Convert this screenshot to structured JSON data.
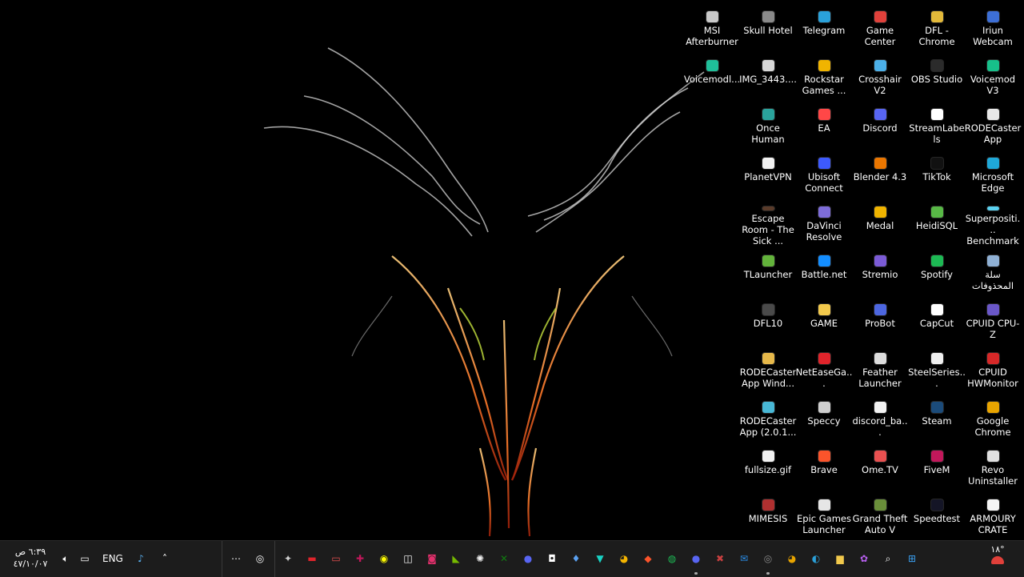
{
  "desktop": {
    "icons": [
      {
        "label": "MSI Afterburner",
        "color": "#c9c9c9"
      },
      {
        "label": "Skull Hotel",
        "color": "#8a8a8a"
      },
      {
        "label": "Telegram",
        "color": "#2aa1da"
      },
      {
        "label": "Game Center",
        "color": "#e0413b"
      },
      {
        "label": "DFL - Chrome",
        "color": "#e3b93a"
      },
      {
        "label": "Iriun Webcam",
        "color": "#3d6fd6"
      },
      {
        "label": "Voicemodl...",
        "color": "#1fbf9a"
      },
      {
        "label": "IMG_3443....",
        "color": "#d7d7d7"
      },
      {
        "label": "Rockstar Games ...",
        "color": "#f0b400"
      },
      {
        "label": "Crosshair V2",
        "color": "#4cb0e8"
      },
      {
        "label": "OBS Studio",
        "color": "#2b2b2b"
      },
      {
        "label": "Voicemod V3",
        "color": "#17c08a"
      },
      {
        "label": "Once Human",
        "color": "#2aa39c"
      },
      {
        "label": "EA",
        "color": "#ff4747"
      },
      {
        "label": "Discord",
        "color": "#5865f2"
      },
      {
        "label": "StreamLabels",
        "color": "#ffffff"
      },
      {
        "label": "RODECaster App",
        "color": "#e8e8e8"
      },
      {
        "label": "PlanetVPN",
        "color": "#f2f2f2"
      },
      {
        "label": "Ubisoft Connect",
        "color": "#3d5afe"
      },
      {
        "label": "Blender 4.3",
        "color": "#ea7600"
      },
      {
        "label": "TikTok",
        "color": "#111111"
      },
      {
        "label": "Microsoft Edge",
        "color": "#1fa8d8"
      },
      {
        "label": "Escape Room - The Sick ...",
        "color": "#5a3b2a"
      },
      {
        "label": "DaVinci Resolve",
        "color": "#7d6cd9"
      },
      {
        "label": "Medal",
        "color": "#f0b400"
      },
      {
        "label": "HeidiSQL",
        "color": "#58b846"
      },
      {
        "label": "Superpositi... Benchmark",
        "color": "#5ad1f0"
      },
      {
        "label": "TLauncher",
        "color": "#63b33b"
      },
      {
        "label": "Battle.net",
        "color": "#148eff"
      },
      {
        "label": "Stremio",
        "color": "#7b5bd6"
      },
      {
        "label": "Spotify",
        "color": "#1db954"
      },
      {
        "label": "سلة المحذوفات",
        "color": "#8fb0d4"
      },
      {
        "label": "DFL10",
        "color": "#4a4a4a"
      },
      {
        "label": "GAME",
        "color": "#f2c94c"
      },
      {
        "label": "ProBot",
        "color": "#4c66e0"
      },
      {
        "label": "CapCut",
        "color": "#ffffff"
      },
      {
        "label": "CPUID CPU-Z",
        "color": "#6a57c8"
      },
      {
        "label": "RODECaster App Wind...",
        "color": "#e6b84a"
      },
      {
        "label": "NetEaseGa...",
        "color": "#e0242b"
      },
      {
        "label": "Feather Launcher",
        "color": "#dcdcdc"
      },
      {
        "label": "SteelSeries...",
        "color": "#f0f0f0"
      },
      {
        "label": "CPUID HWMonitor",
        "color": "#d62828"
      },
      {
        "label": "RODECaster App (2.0.1...",
        "color": "#48b8d6"
      },
      {
        "label": "Speccy",
        "color": "#cfcfcf"
      },
      {
        "label": "discord_ba...",
        "color": "#f2f2f2"
      },
      {
        "label": "Steam",
        "color": "#1b4b7a"
      },
      {
        "label": "Google Chrome",
        "color": "#e8a400"
      },
      {
        "label": "fullsize.gif",
        "color": "#f2f2f2"
      },
      {
        "label": "Brave",
        "color": "#fb542b"
      },
      {
        "label": "Ome.TV",
        "color": "#e85050"
      },
      {
        "label": "FiveM",
        "color": "#c2185b"
      },
      {
        "label": "Revo Uninstaller",
        "color": "#e0e0e0"
      },
      {
        "label": "MIMESIS",
        "color": "#b03030"
      },
      {
        "label": "Epic Games Launcher",
        "color": "#e6e6e6"
      },
      {
        "label": "Grand Theft Auto V",
        "color": "#6a8f3a"
      },
      {
        "label": "Speedtest",
        "color": "#141526"
      },
      {
        "label": "ARMOURY CRATE",
        "color": "#f5f5f5"
      }
    ]
  },
  "taskbar": {
    "clock_time": "٦:٣٩ ص",
    "clock_date": "٤٧/١٠/٠٧",
    "language": "ENG",
    "weather_temp": "١٨°",
    "apps": [
      {
        "name": "search-app-icon",
        "color": "#ffffff",
        "glyph": "◎"
      },
      {
        "name": "msi-afterburner-icon",
        "color": "#d0d0d0",
        "glyph": "✦"
      },
      {
        "name": "netease-icon",
        "color": "#e0242b",
        "glyph": "▬"
      },
      {
        "name": "ome-tv-icon",
        "color": "#e85050",
        "glyph": "▭"
      },
      {
        "name": "fivem-icon",
        "color": "#c2185b",
        "glyph": "✚"
      },
      {
        "name": "snapchat-icon",
        "color": "#fffc00",
        "glyph": "◉"
      },
      {
        "name": "capcut-icon",
        "color": "#ffffff",
        "glyph": "◫"
      },
      {
        "name": "instagram-icon",
        "color": "#e1306c",
        "glyph": "◙"
      },
      {
        "name": "nvidia-icon",
        "color": "#76b900",
        "glyph": "◣"
      },
      {
        "name": "steelseries-icon",
        "color": "#f0f0f0",
        "glyph": "✺"
      },
      {
        "name": "xbox-icon",
        "color": "#107c10",
        "glyph": "✕"
      },
      {
        "name": "discord-icon",
        "color": "#5865f2",
        "glyph": "●"
      },
      {
        "name": "streamlabs-icon",
        "color": "#ffffff",
        "glyph": "◘"
      },
      {
        "name": "droplet-app-icon",
        "color": "#5aa0f0",
        "glyph": "♦"
      },
      {
        "name": "vpn-icon",
        "color": "#19d3c5",
        "glyph": "▼"
      },
      {
        "name": "chrome-icon",
        "color": "#f4b400",
        "glyph": "◕"
      },
      {
        "name": "brave-icon",
        "color": "#fb542b",
        "glyph": "◆"
      },
      {
        "name": "spotify-icon",
        "color": "#1db954",
        "glyph": "◍"
      },
      {
        "name": "discord-2-icon",
        "color": "#5865f2",
        "glyph": "●"
      },
      {
        "name": "tool-app-icon",
        "color": "#c94040",
        "glyph": "✖"
      },
      {
        "name": "outlook-icon",
        "color": "#2a8ee8",
        "glyph": "✉"
      },
      {
        "name": "obs-icon",
        "color": "#888888",
        "glyph": "◎"
      },
      {
        "name": "google-chrome-icon",
        "color": "#e8a400",
        "glyph": "◕"
      },
      {
        "name": "edge-icon",
        "color": "#2a9fd8",
        "glyph": "◐"
      },
      {
        "name": "file-explorer-icon",
        "color": "#f2c94c",
        "glyph": "▆"
      },
      {
        "name": "copilot-icon",
        "color": "#b860f0",
        "glyph": "✿"
      },
      {
        "name": "search-icon",
        "color": "#ffffff",
        "glyph": "⌕"
      },
      {
        "name": "start-icon",
        "color": "#3aa0f0",
        "glyph": "⊞"
      }
    ]
  }
}
